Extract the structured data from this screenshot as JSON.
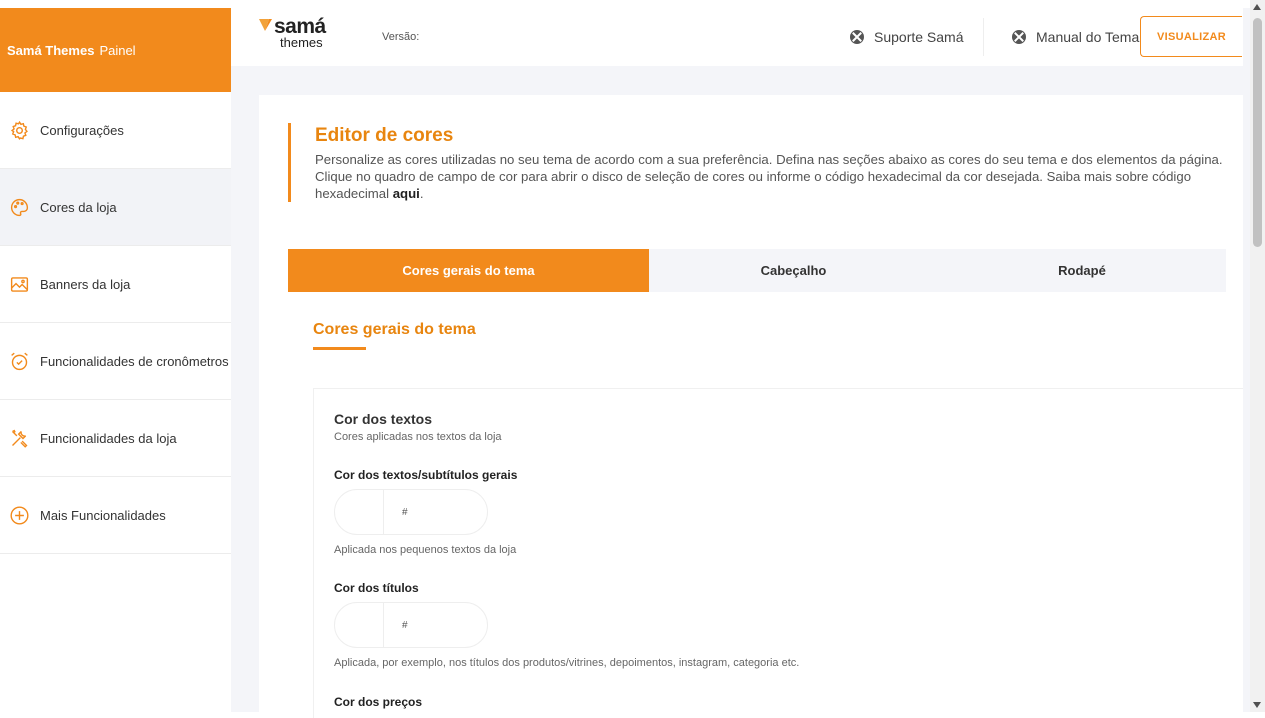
{
  "sidebar": {
    "brand_bold": "Samá Themes",
    "brand_sub": "Painel",
    "items": [
      {
        "label": "Configurações",
        "icon": "gear-icon"
      },
      {
        "label": "Cores da loja",
        "icon": "palette-icon"
      },
      {
        "label": "Banners da loja",
        "icon": "image-icon"
      },
      {
        "label": "Funcionalidades de cronômetros",
        "icon": "alarm-clock-icon"
      },
      {
        "label": "Funcionalidades da loja",
        "icon": "tools-icon"
      },
      {
        "label": "Mais Funcionalidades",
        "icon": "plus-circle-icon"
      }
    ]
  },
  "header": {
    "logo_line1": "samá",
    "logo_line2": "themes",
    "version_label": "Versão:",
    "support_link": "Suporte Samá",
    "manual_link": "Manual do Tema",
    "view_button": "VISUALIZAR"
  },
  "editor": {
    "title": "Editor de cores",
    "description": "Personalize as cores utilizadas no seu tema de acordo com a sua preferência. Defina nas seções abaixo as cores do seu tema e dos elementos da página. Clique no quadro de campo de cor para abrir o disco de seleção de cores ou informe o código hexadecimal da cor desejada. Saiba mais sobre código hexadecimal ",
    "link_text": "aqui",
    "link_suffix": "."
  },
  "tabs": [
    {
      "label": "Cores gerais do tema",
      "active": true
    },
    {
      "label": "Cabeçalho",
      "active": false
    },
    {
      "label": "Rodapé",
      "active": false
    }
  ],
  "section": {
    "title": "Cores gerais do tema",
    "group_title": "Cor dos textos",
    "group_desc": "Cores aplicadas nos textos da loja",
    "fields": [
      {
        "label": "Cor dos textos/subtítulos gerais",
        "value": "#",
        "help": "Aplicada nos pequenos textos da loja"
      },
      {
        "label": "Cor dos títulos",
        "value": "#",
        "help": "Aplicada, por exemplo, nos títulos dos produtos/vitrines, depoimentos, instagram, categoria etc."
      },
      {
        "label": "Cor dos preços",
        "value": "",
        "help": ""
      }
    ]
  },
  "colors": {
    "accent": "#f28a1c",
    "accent_text": "#e8850f",
    "page_bg": "#f4f5f9"
  }
}
